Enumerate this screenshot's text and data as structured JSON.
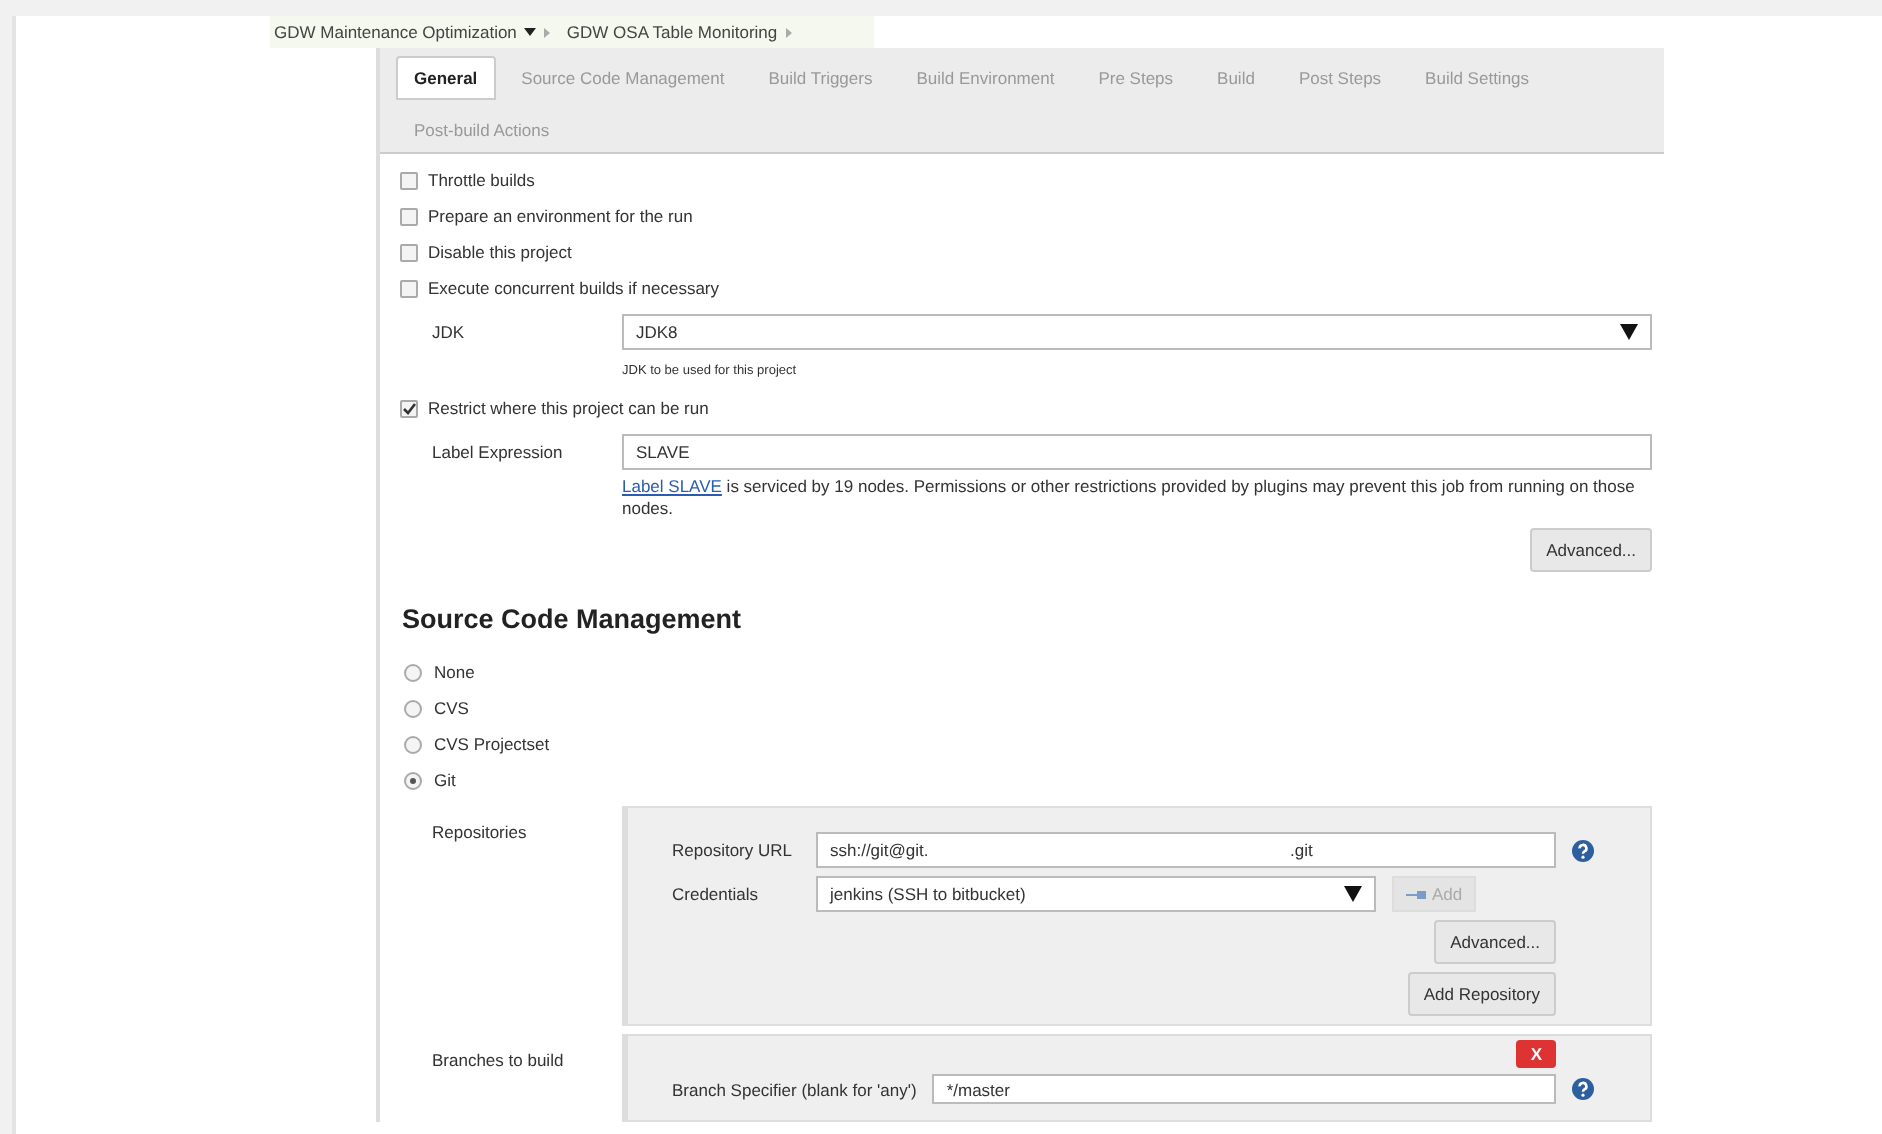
{
  "breadcrumbs": [
    {
      "label": "GDW Maintenance Optimization",
      "dropdown": true
    },
    {
      "label": "GDW OSA Table Monitoring",
      "dropdown": false
    }
  ],
  "tabs": [
    {
      "label": "General",
      "selected": true
    },
    {
      "label": "Source Code Management",
      "selected": false
    },
    {
      "label": "Build Triggers",
      "selected": false
    },
    {
      "label": "Build Environment",
      "selected": false
    },
    {
      "label": "Pre Steps",
      "selected": false
    },
    {
      "label": "Build",
      "selected": false
    },
    {
      "label": "Post Steps",
      "selected": false
    },
    {
      "label": "Build Settings",
      "selected": false
    },
    {
      "label": "Post-build Actions",
      "selected": false
    }
  ],
  "options": [
    {
      "label": "Throttle builds",
      "checked": false
    },
    {
      "label": "Prepare an environment for the run",
      "checked": false
    },
    {
      "label": "Disable this project",
      "checked": false
    },
    {
      "label": "Execute concurrent builds if necessary",
      "checked": false
    }
  ],
  "jdk": {
    "label": "JDK",
    "value": "JDK8",
    "help": "JDK to be used for this project"
  },
  "restrict": {
    "label": "Restrict where this project can be run",
    "checked": true,
    "field_label": "Label Expression",
    "value": "SLAVE",
    "link": "Label SLAVE",
    "message": " is serviced by 19 nodes. Permissions or other restrictions provided by plugins may prevent this job from running on those nodes.",
    "button": "Advanced..."
  },
  "scm": {
    "title": "Source Code Management",
    "choices": [
      {
        "label": "None",
        "selected": false
      },
      {
        "label": "CVS",
        "selected": false
      },
      {
        "label": "CVS Projectset",
        "selected": false
      },
      {
        "label": "Git",
        "selected": true
      }
    ],
    "repositories_label": "Repositories",
    "url_label": "Repository URL",
    "url_start": "ssh://git@git.",
    "url_end": ".git",
    "credentials_label": "Credentials",
    "credentials": "jenkins (SSH to bitbucket)",
    "add": "Add",
    "advanced": "Advanced...",
    "add_repository": "Add Repository",
    "branches_label": "Branches to build",
    "delete": "X",
    "branch_label": "Branch Specifier (blank for 'any')",
    "branch": "*/master"
  }
}
